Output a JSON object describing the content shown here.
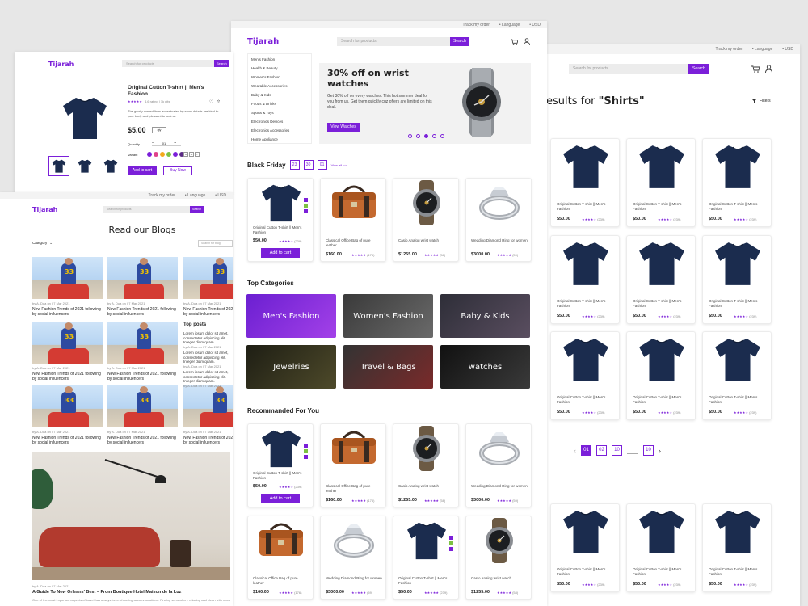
{
  "common": {
    "logo": "Tijarah",
    "search_placeholder": "Search for products",
    "search_button": "Search",
    "track_order": "Track my order",
    "language": "• Language",
    "currency": "• USD",
    "brand_color": "#7b1fd9"
  },
  "product_detail": {
    "title": "Original Cutton T-shirt || Men's Fashion",
    "rating_text": "4.6 rating | 1k pits",
    "rating_stars": "★★★★★",
    "description": "The gently curved lines accentuated by sewn details are kind to your body and pleasant to look at.",
    "price": "$5.00",
    "price_select": "qty",
    "quantity_label": "Quantity",
    "quantity_minus": "–",
    "quantity_value": "01",
    "quantity_plus": "+",
    "variant_label": "Variant",
    "variant_colors": [
      "#7b1fd9",
      "#e0438a",
      "#f4a91c",
      "#7cc242",
      "#7b1fd9",
      "#5b2a86"
    ],
    "size_options": [
      "s",
      "m",
      "l"
    ],
    "add_to_cart": "Add to cart",
    "buy_now": "Buy Now"
  },
  "blog": {
    "title": "Read our Blogs",
    "category": "Category",
    "search_placeholder": "Search for blog",
    "post_meta": "by A. Dua on 07 Mar 2021",
    "post_title": "New Fashion Trends of 2021 following by social influencers",
    "top_posts_title": "Top posts",
    "top_posts": [
      {
        "text": "Lorem ipsum dolor sit amet, consectetur adipiscing elit. Integer diam quam.",
        "meta": "by A. Dua on 07 Mar 2021"
      },
      {
        "text": "Lorem ipsum dolor sit amet, consectetur adipiscing elit. Integer diam quam.",
        "meta": "by A. Dua on 07 Mar 2021"
      },
      {
        "text": "Lorem ipsum dolor sit amet, consectetur adipiscing elit. Integer diam quam.",
        "meta": "by A. Dua on 07 Mar 2021"
      }
    ],
    "featured_meta": "by A. Dua on 07 Mar 2021",
    "featured_title": "A Guide To New Orleans' Best – From Boutique Hotel Maison de la Luz",
    "featured_excerpt": "One of the most important aspects of travel has always been choosing accommodations. Finding somewhere relaxing and clean with modern furnishings and amenities..."
  },
  "home": {
    "sidebar": [
      "Men's Fashion",
      "Health & Beauty",
      "Women's Fashion",
      "Wearable Accessories",
      "Baby & Kids",
      "Foods & Drinks",
      "Sports & Toys",
      "Electronics Devices",
      "Electronics Accessories",
      "Home Appliance"
    ],
    "hero_title": "30% off on wrist watches",
    "hero_text": "Get 30% off on every watches. This hot summer deal for you from us. Get them quickly cuz offers are limited on this deal.",
    "hero_button": "View Watches",
    "black_friday": "Black Friday",
    "timer": [
      "23",
      "30",
      "01"
    ],
    "view_all": "View all >>",
    "top_categories": "Top Categories",
    "categories": [
      "Men's Fashion",
      "Women's Fashion",
      "Baby & Kids",
      "Jewelries",
      "Travel & Bags",
      "watches"
    ],
    "recommended": "Recommanded For You",
    "add_to_cart": "Add to cart",
    "bf_products": [
      {
        "name": "Original Cutton T-shirt || Men's Fashion",
        "price": "$50.00",
        "stars": "★★★★☆",
        "count": "(239)",
        "img": "tshirt"
      },
      {
        "name": "Classical Office Bag of pure leather",
        "price": "$160.00",
        "stars": "★★★★★",
        "count": "(176)",
        "img": "bag"
      },
      {
        "name": "Casio Analog wrist watch",
        "price": "$1255.00",
        "stars": "★★★★★",
        "count": "(58)",
        "img": "watch"
      },
      {
        "name": "Wedding Diamond Ring for women",
        "price": "$3000.00",
        "stars": "★★★★★",
        "count": "(59)",
        "img": "ring"
      }
    ],
    "rec_products": [
      {
        "name": "Original Cutton T-shirt || Men's Fashion",
        "price": "$50.00",
        "stars": "★★★★☆",
        "count": "(239)",
        "img": "tshirt"
      },
      {
        "name": "Classical Office Bag of pure leather",
        "price": "$160.00",
        "stars": "★★★★★",
        "count": "(176)",
        "img": "bag"
      },
      {
        "name": "Casio Analog wrist watch",
        "price": "$1255.00",
        "stars": "★★★★★",
        "count": "(58)",
        "img": "watch"
      },
      {
        "name": "Wedding Diamond Ring for women",
        "price": "$3000.00",
        "stars": "★★★★★",
        "count": "(59)",
        "img": "ring"
      },
      {
        "name": "Classical Office Bag of pure leather",
        "price": "$160.00",
        "stars": "★★★★★",
        "count": "(176)",
        "img": "bag"
      },
      {
        "name": "Wedding Diamond Ring for women",
        "price": "$3000.00",
        "stars": "★★★★★",
        "count": "(59)",
        "img": "ring"
      },
      {
        "name": "Original Cutton T-shirt || Men's Fashion",
        "price": "$50.00",
        "stars": "★★★★★",
        "count": "(239)",
        "img": "tshirt"
      },
      {
        "name": "Casio Analog wrist watch",
        "price": "$1255.00",
        "stars": "★★★★★",
        "count": "(58)",
        "img": "watch"
      }
    ]
  },
  "results": {
    "title_prefix": "esults for ",
    "query": "\"Shirts\"",
    "filters": "Filters",
    "product_name": "Original Cutton T-shirt || Men's Fashion",
    "product_price": "$50.00",
    "product_stars": "★★★★☆",
    "product_count": "(239)",
    "pages": [
      "01",
      "02",
      "10",
      "10"
    ],
    "prev": "‹",
    "next": "›"
  }
}
